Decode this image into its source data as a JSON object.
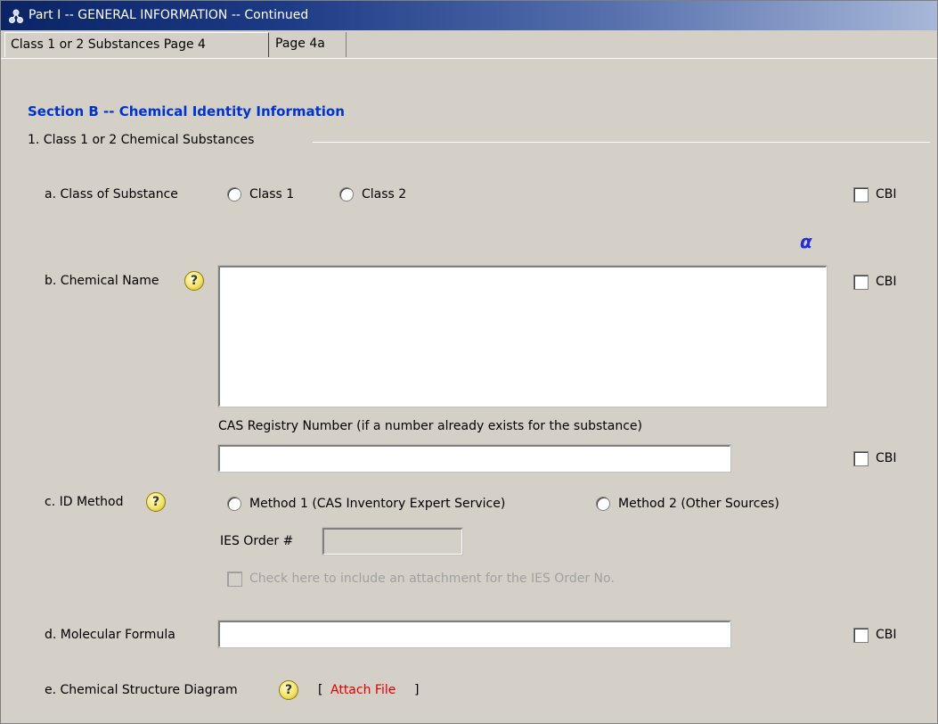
{
  "window": {
    "title": "Part I -- GENERAL INFORMATION -- Continued"
  },
  "tabs": [
    {
      "label": "Class 1 or 2 Substances Page 4",
      "active": true
    },
    {
      "label": "Page 4a",
      "active": false
    }
  ],
  "section": {
    "title": "Section B -- Chemical Identity Information",
    "subheading": "1.  Class 1 or 2 Chemical Substances"
  },
  "class_of_substance": {
    "label": "a. Class of Substance",
    "options": [
      "Class 1",
      "Class 2"
    ],
    "cbi_label": "CBI"
  },
  "alpha_symbol": "α",
  "chemical_name": {
    "label": "b. Chemical Name",
    "help": "?",
    "value": "",
    "cbi_label": "CBI"
  },
  "cas_registry": {
    "label": "CAS Registry Number (if a number already exists for the substance)",
    "value": "",
    "cbi_label": "CBI"
  },
  "id_method": {
    "label": "c. ID Method",
    "help": "?",
    "option1": "Method 1 (CAS Inventory Expert Service)",
    "option2": "Method 2 (Other Sources)",
    "ies_label": "IES Order #",
    "ies_value": "",
    "attach_checkbox_label": "Check here to include an attachment for the IES Order No."
  },
  "molecular_formula": {
    "label": "d. Molecular Formula",
    "value": "",
    "cbi_label": "CBI"
  },
  "structure_diagram": {
    "label": "e. Chemical Structure Diagram",
    "help": "?",
    "bracket_open": "[",
    "attach_link": "Attach File",
    "bracket_close": "]"
  },
  "colors": {
    "section_title": "#0033cc",
    "attach_link": "#e00000",
    "alpha": "#1f2fd8"
  }
}
